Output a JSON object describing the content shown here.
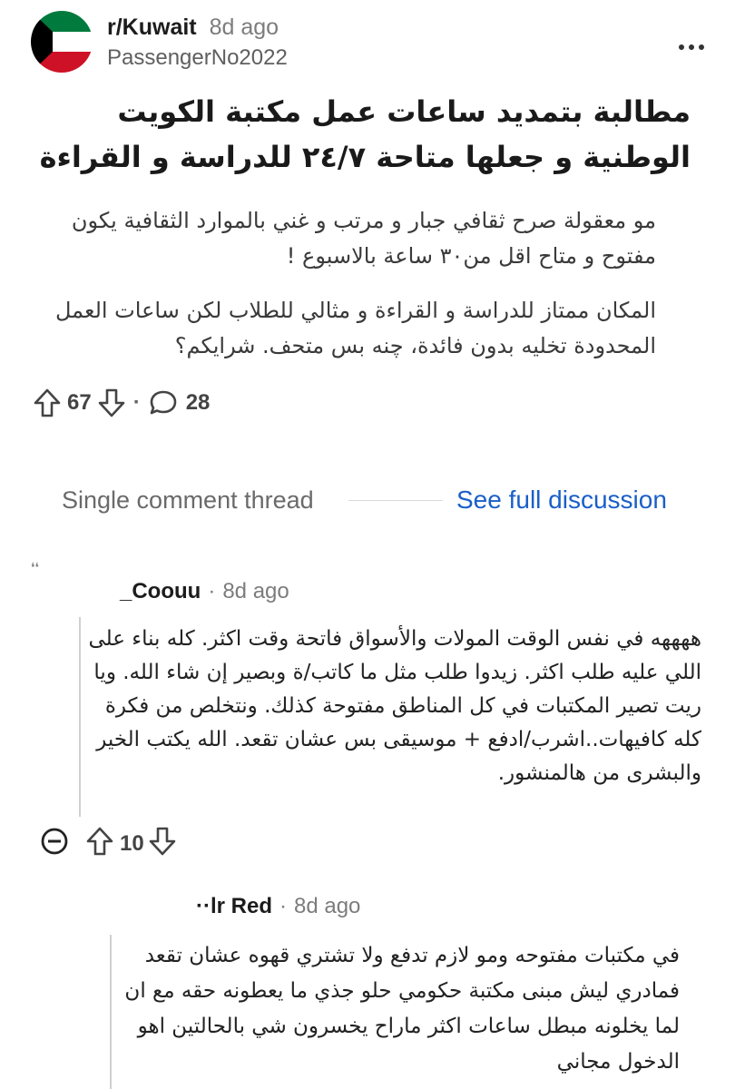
{
  "post": {
    "subreddit": "r/Kuwait",
    "age": "8d ago",
    "author": "PassengerNo2022",
    "title": "مطالبة بتمديد ساعات عمل مكتبة الكويت الوطنية و جعلها متاحة ٢٤/٧ للدراسة و القراءة",
    "paragraph1": "مو معقولة صرح ثقافي جبار و مرتب و غني بالموارد الثقافية يكون مفتوح و متاح اقل من٣٠ ساعة بالاسبوع !",
    "paragraph2": "المكان ممتاز للدراسة و القراءة و مثالي للطلاب لكن ساعات العمل المحدودة تخليه بدون فائدة، چنه بس متحف. شرايكم؟",
    "upvotes": "67",
    "dot": "·",
    "comments": "28"
  },
  "thread": {
    "label": "Single comment thread",
    "link": "See full discussion"
  },
  "comment1": {
    "author": "_Coouu",
    "age": "8d ago",
    "text": "ههههه في نفس الوقت المولات والأسواق فاتحة وقت اكثر. كله بناء على اللي عليه طلب اكثر. زيدوا طلب مثل ما كاتب/ة وبصير إن شاء الله. ويا ريت تصير المكتبات في كل المناطق مفتوحة كذلك. ونتخلص من فكرة كله كافيهات..اشرب/ادفع + موسيقى بس عشان تقعد. الله يكتب الخير والبشرى من هالمنشور.",
    "score": "10"
  },
  "comment2": {
    "author": "··lr Red",
    "age": "8d ago",
    "text": "في مكتبات مفتوحه ومو لازم تدفع ولا تشتري قهوه عشان تقعد فمادري ليش مبنى مكتبة حكومي حلو جذي ما يعطونه حقه مع ان لما يخلونه مبطل ساعات اكثر ماراح يخسرون شي بالحالتين اهو الدخول مجاني"
  },
  "icons": {
    "avatar": "kuwait-flag-icon",
    "more": "more-options-icon",
    "upvote": "upvote-arrow-icon",
    "downvote": "downvote-arrow-icon",
    "comment": "comment-bubble-icon",
    "collapse": "collapse-minus-icon"
  },
  "colors": {
    "link": "#1a5fc8",
    "flag_green": "#007a3d",
    "flag_red": "#ce1126",
    "flag_black": "#000000"
  }
}
